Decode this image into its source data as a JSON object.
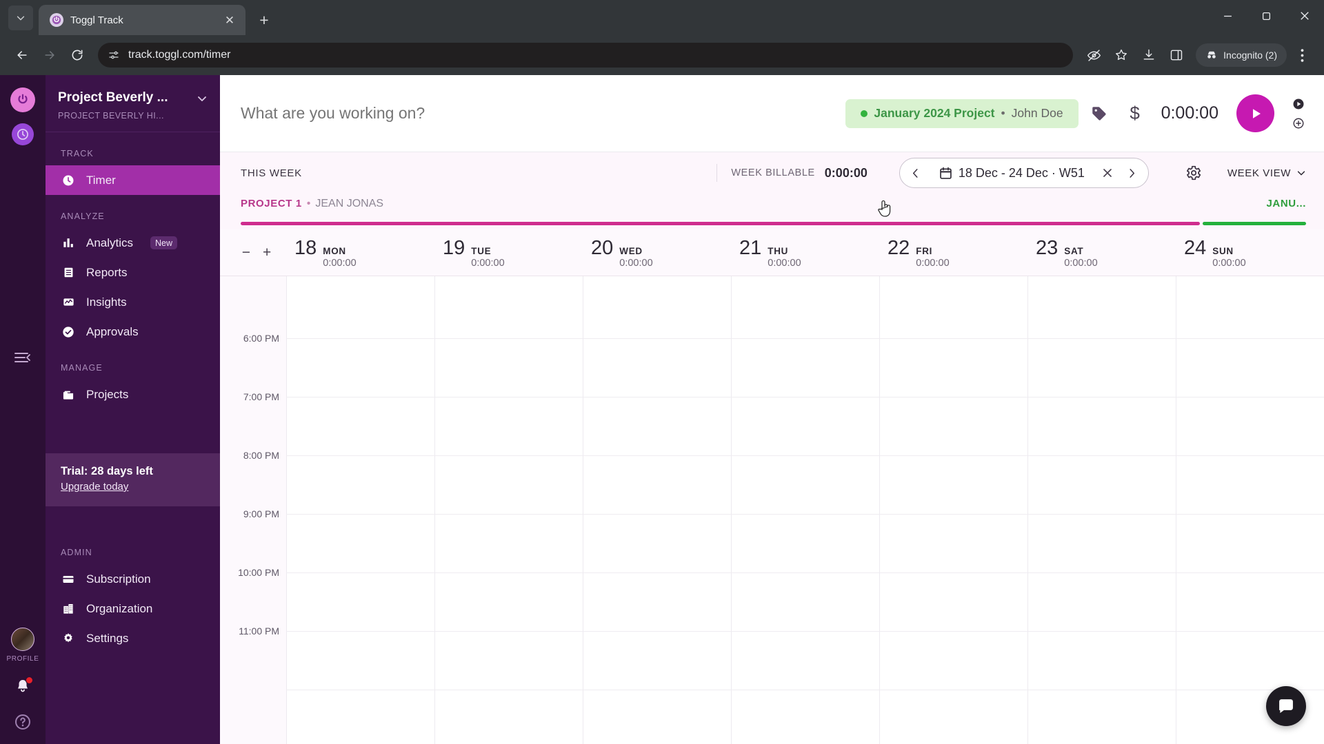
{
  "browser": {
    "tab": {
      "title": "Toggl Track",
      "favicon_icon": "toggl-power-icon",
      "close_icon": "close-icon"
    },
    "tab_search_icon": "tab-search-chevron-icon",
    "new_tab_icon": "new-tab-plus-icon",
    "window_controls": {
      "minimize": "minimize-icon",
      "maximize": "maximize-icon",
      "close": "close-icon"
    },
    "nav": {
      "back_icon": "back-arrow-icon",
      "forward_icon": "forward-arrow-icon",
      "reload_icon": "reload-icon"
    },
    "omnibox": {
      "site_info_icon": "site-settings-icon",
      "url": "track.toggl.com/timer"
    },
    "toolbar_icons": [
      "eye-off-icon",
      "bookmark-star-icon",
      "download-icon",
      "side-panel-icon"
    ],
    "incognito": {
      "label": "Incognito (2)",
      "icon": "incognito-hat-icon"
    },
    "menu_icon": "three-dot-menu-icon"
  },
  "rail": {
    "logo_icon": "toggl-power-logo-icon",
    "app_switch_icon": "toggl-track-circle-icon",
    "collapse_icon": "collapse-sidebar-icon",
    "profile_label": "PROFILE",
    "avatar_icon": "user-avatar",
    "notifications_icon": "bell-icon",
    "help_icon": "help-question-icon"
  },
  "sidebar": {
    "workspace": {
      "title": "Project Beverly ...",
      "subtitle": "PROJECT BEVERLY HI...",
      "chevron_icon": "chevron-down-icon"
    },
    "sections": [
      {
        "title": "TRACK",
        "items": [
          {
            "label": "Timer",
            "icon": "clock-icon",
            "active": true
          }
        ]
      },
      {
        "title": "ANALYZE",
        "items": [
          {
            "label": "Analytics",
            "icon": "bar-chart-icon",
            "badge": "New",
            "active": false
          },
          {
            "label": "Reports",
            "icon": "report-list-icon",
            "active": false
          },
          {
            "label": "Insights",
            "icon": "insights-pulse-icon",
            "active": false
          },
          {
            "label": "Approvals",
            "icon": "check-circle-icon",
            "active": false
          }
        ]
      },
      {
        "title": "MANAGE",
        "items": [
          {
            "label": "Projects",
            "icon": "folder-icon",
            "active": false
          }
        ]
      }
    ],
    "trial": {
      "title": "Trial: 28 days left",
      "link": "Upgrade today"
    },
    "admin": {
      "title": "ADMIN",
      "items": [
        {
          "label": "Subscription",
          "icon": "credit-card-icon"
        },
        {
          "label": "Organization",
          "icon": "building-icon"
        },
        {
          "label": "Settings",
          "icon": "gear-icon"
        }
      ]
    }
  },
  "timer_bar": {
    "placeholder": "What are you working on?",
    "value": "",
    "project_chip": {
      "dot_color": "#33b33e",
      "project": "January 2024 Project",
      "separator": "•",
      "user": "John Doe"
    },
    "tag_icon": "tag-icon",
    "billable_icon": "$",
    "duration": "0:00:00",
    "play_icon": "play-icon",
    "mode_timer_icon": "timer-mode-icon",
    "mode_manual_icon": "manual-add-icon"
  },
  "week_bar": {
    "this_week": "THIS WEEK",
    "billable_label": "WEEK BILLABLE",
    "billable_value": "0:00:00",
    "date_picker": {
      "prev_icon": "chevron-left-icon",
      "calendar_icon": "calendar-icon",
      "range": "18 Dec - 24 Dec · W51",
      "clear_icon": "close-x-icon",
      "next_icon": "chevron-right-icon"
    },
    "settings_icon": "gear-icon",
    "view_label": "WEEK VIEW",
    "view_chevron_icon": "chevron-down-icon"
  },
  "project_strip": {
    "label": "PROJECT 1",
    "separator": "•",
    "user": "JEAN JONAS",
    "right_label": "JANU...",
    "bar_color": "#cf2d8e",
    "bar_alt_color": "#24b03c"
  },
  "day_header": {
    "zoom_out_icon": "minus-icon",
    "zoom_in_icon": "plus-icon",
    "days": [
      {
        "num": "18",
        "name": "MON",
        "total": "0:00:00"
      },
      {
        "num": "19",
        "name": "TUE",
        "total": "0:00:00"
      },
      {
        "num": "20",
        "name": "WED",
        "total": "0:00:00"
      },
      {
        "num": "21",
        "name": "THU",
        "total": "0:00:00"
      },
      {
        "num": "22",
        "name": "FRI",
        "total": "0:00:00"
      },
      {
        "num": "23",
        "name": "SAT",
        "total": "0:00:00"
      },
      {
        "num": "24",
        "name": "SUN",
        "total": "0:00:00"
      }
    ]
  },
  "calendar": {
    "time_labels": [
      "6:00 PM",
      "7:00 PM",
      "8:00 PM",
      "9:00 PM",
      "10:00 PM",
      "11:00 PM"
    ],
    "chat_icon": "chat-bubble-icon"
  }
}
